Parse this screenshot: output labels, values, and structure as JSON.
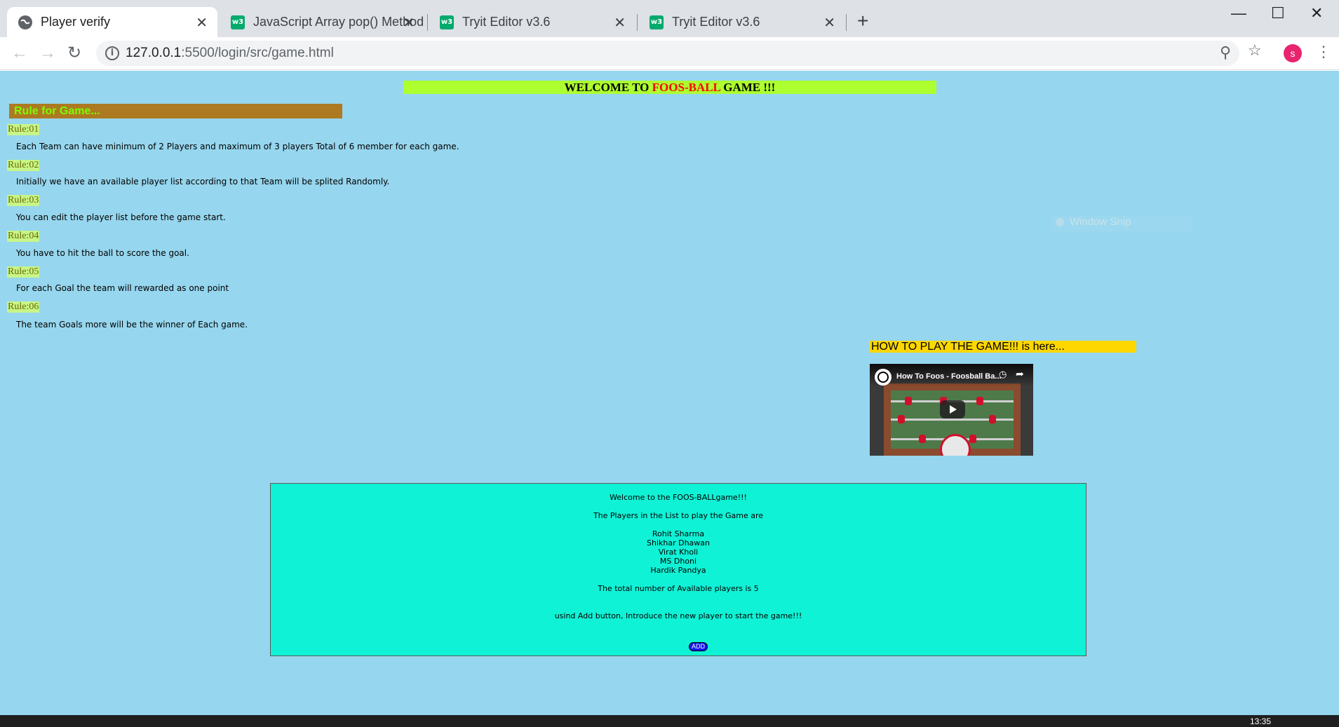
{
  "browser": {
    "tabs": [
      {
        "title": "Player verify",
        "favicon": "globe-icon",
        "active": true
      },
      {
        "title": "JavaScript Array pop() Method",
        "favicon": "w3-icon",
        "active": false
      },
      {
        "title": "Tryit Editor v3.6",
        "favicon": "w3-icon",
        "active": false
      },
      {
        "title": "Tryit Editor v3.6",
        "favicon": "w3-icon",
        "active": false
      }
    ],
    "favicon_text": "w3",
    "url_host": "127.0.0.1",
    "url_path": ":5500/login/src/game.html",
    "profile_initial": "s"
  },
  "page": {
    "welcome_prefix": "WELCOME TO ",
    "welcome_highlight": "FOOS-BALL",
    "welcome_suffix": " GAME !!!",
    "rules_header": "Rule for Game...",
    "rules": [
      {
        "label": "Rule:01",
        "text": "Each Team can have minimum of 2 Players and maximum of 3 players Total of 6 member for each game."
      },
      {
        "label": "Rule:02",
        "text": "Initially we have an available player list according to that Team will be splited Randomly."
      },
      {
        "label": "Rule:03",
        "text": "You can edit the player list before the game start."
      },
      {
        "label": "Rule:04",
        "text": "You have to hit the ball to score the goal."
      },
      {
        "label": "Rule:05",
        "text": "For each Goal the team will rewarded as one point"
      },
      {
        "label": "Rule:06",
        "text": "The team Goals more will be the winner of Each game."
      }
    ],
    "howto_text": "HOW TO PLAY THE GAME!!! is here...",
    "video": {
      "title": "How To Foos - Foosball Ba...",
      "channel_badge": "HOW TO FOOS"
    },
    "overlay_text": "Window Snip",
    "game_box": {
      "welcome": "Welcome to the FOOS-BALLgame!!!",
      "players_intro": "The Players in the List to play the Game are",
      "players": [
        "Rohit Sharma",
        "Shikhar Dhawan",
        "Virat Kholi",
        "MS Dhoni",
        "Hardik Pandya"
      ],
      "total": "The total number of Available players is 5",
      "instruction": "usind Add button, Introduce the new player to start the game!!!",
      "add_button": "ADD"
    }
  },
  "taskbar": {
    "clock": "13:35"
  },
  "colors": {
    "page_bg": "#96d6ee",
    "welcome_bg": "#adff2f",
    "rule_header_bg": "#ad7a22",
    "howto_bg": "#ffd700",
    "game_box_bg": "#10f2d6",
    "add_button_bg": "#1515f0"
  }
}
